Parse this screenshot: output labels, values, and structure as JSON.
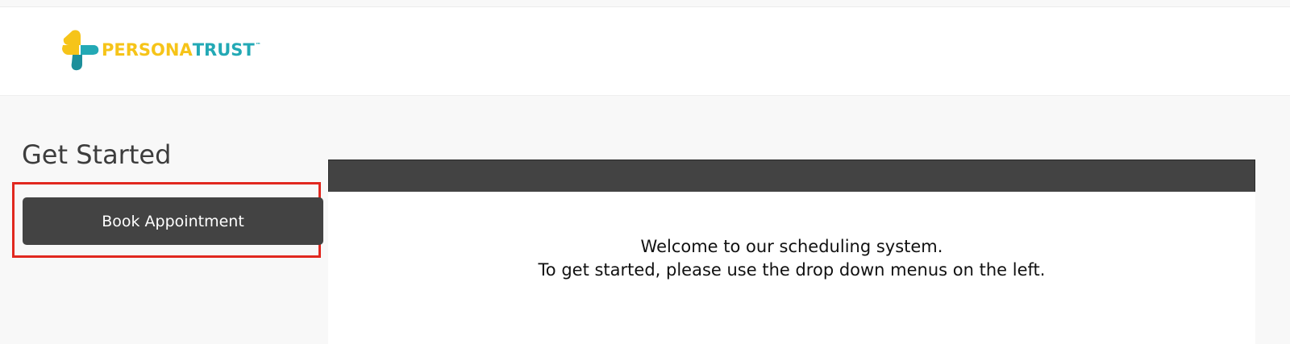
{
  "brand": {
    "name_part1": "PERSONA",
    "name_part2": "TRUST",
    "trademark": "™",
    "colors": {
      "yellow": "#f6c419",
      "teal": "#23a9b5"
    }
  },
  "sidebar": {
    "title": "Get Started",
    "book_button_label": "Book Appointment"
  },
  "main": {
    "welcome_line1": "Welcome to our scheduling system.",
    "welcome_line2": "To get started, please use the drop down menus on the left."
  },
  "colors": {
    "dark": "#434343",
    "highlight": "#e1281f",
    "background": "#f8f8f8"
  }
}
